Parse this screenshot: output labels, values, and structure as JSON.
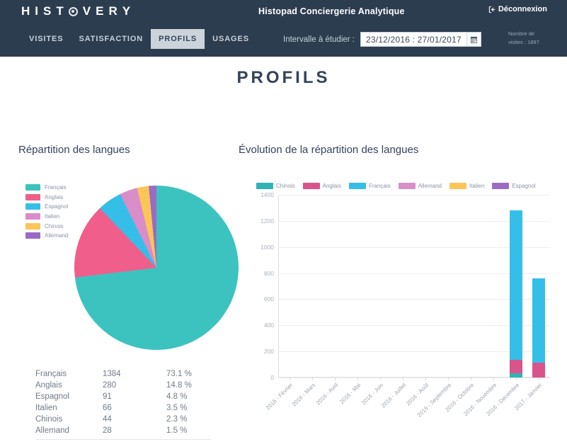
{
  "header": {
    "logo_text": "HISTOVERY",
    "logo_letters": [
      "H",
      "I",
      "S",
      "T",
      "O",
      "V",
      "E",
      "R",
      "Y"
    ],
    "app_title": "Histopad Conciergerie Analytique",
    "logout_label": "Déconnexion",
    "logout_icon": "logout-icon",
    "nav": [
      {
        "label": "VISITES",
        "active": false
      },
      {
        "label": "SATISFACTION",
        "active": false
      },
      {
        "label": "PROFILS",
        "active": true
      },
      {
        "label": "USAGES",
        "active": false
      }
    ],
    "daterange": {
      "label": "Intervalle à étudier :",
      "value": "23/12/2016 : 27/01/2017",
      "placeholder": "jj/mm/aaaa : jj/mm/aaaa",
      "calendar_icon": "calendar-icon"
    },
    "visit_count_line1": "Nombre de",
    "visit_count_line2": "visites : 1897"
  },
  "page": {
    "title": "PROFILS"
  },
  "panels": {
    "left_title": "Répartition des langues",
    "right_title": "Évolution de la répartition des langues"
  },
  "colors": {
    "navy": "#2d3d50",
    "teal": "#3cc3c0",
    "pink": "#f05f8c",
    "blue": "#35bfe8",
    "lilac": "#d98ec9",
    "yellow": "#fcc558",
    "purple": "#9b6bc4",
    "bar_teal": "#2fb3b5",
    "bar_pink": "#d9548a",
    "bar_blue": "#35bfe8"
  },
  "chart_data": [
    {
      "type": "pie",
      "title": "Répartition des langues",
      "legend_position": "left",
      "categories": [
        "Français",
        "Anglais",
        "Espagnol",
        "Italien",
        "Chinois",
        "Allemand"
      ],
      "values": [
        1384,
        280,
        91,
        66,
        44,
        28
      ],
      "percents": [
        "73.1 %",
        "14.8 %",
        "4.8 %",
        "3.5 %",
        "2.3 %",
        "1.5 %"
      ],
      "percent_values": [
        73.1,
        14.8,
        4.8,
        3.5,
        2.3,
        1.5
      ],
      "slice_colors": [
        "#3cc3c0",
        "#f05f8c",
        "#35bfe8",
        "#d98ec9",
        "#fcc558",
        "#9b6bc4"
      ],
      "legend": [
        {
          "label": "Français",
          "color": "#3cc3c0"
        },
        {
          "label": "Anglais",
          "color": "#f05f8c"
        },
        {
          "label": "Espagnol",
          "color": "#35bfe8"
        },
        {
          "label": "Italien",
          "color": "#d98ec9"
        },
        {
          "label": "Chinois",
          "color": "#fcc558"
        },
        {
          "label": "Allemand",
          "color": "#9b6bc4"
        }
      ],
      "table": {
        "rows": [
          {
            "lang": "Français",
            "count": "1384",
            "pct": "73.1 %"
          },
          {
            "lang": "Anglais",
            "count": "280",
            "pct": "14.8 %"
          },
          {
            "lang": "Espagnol",
            "count": "91",
            "pct": "4.8 %"
          },
          {
            "lang": "Italien",
            "count": "66",
            "pct": "3.5 %"
          },
          {
            "lang": "Chinois",
            "count": "44",
            "pct": "2.3 %"
          },
          {
            "lang": "Allemand",
            "count": "28",
            "pct": "1.5 %"
          }
        ]
      }
    },
    {
      "type": "bar",
      "stacked": true,
      "title": "Évolution de la répartition des langues",
      "legend_position": "top",
      "xlabel": "",
      "ylabel": "",
      "ylim": [
        0,
        1400
      ],
      "yticks": [
        0,
        200,
        400,
        600,
        800,
        1000,
        1200,
        1400
      ],
      "ytick_labels": [
        "0",
        "200",
        "400",
        "600",
        "800",
        "1000",
        "1200",
        "1400"
      ],
      "grid": true,
      "categories": [
        "2016 - Février",
        "2016 - Mars",
        "2016 - Avril",
        "2016 - Mai",
        "2016 - Juin",
        "2016 - Juillet",
        "2016 - Août",
        "2016 - Septembre",
        "2016 - Octobre",
        "2016 - Novembre",
        "2016 - Décembre",
        "2017 - Janvier"
      ],
      "legend": [
        {
          "label": "Chinois",
          "color": "#2fb3b5"
        },
        {
          "label": "Anglais",
          "color": "#d9548a"
        },
        {
          "label": "Français",
          "color": "#35bfe8"
        },
        {
          "label": "Allemand",
          "color": "#d98ec9"
        },
        {
          "label": "Italien",
          "color": "#fcc558"
        },
        {
          "label": "Espagnol",
          "color": "#9b6bc4"
        }
      ],
      "series": [
        {
          "name": "Chinois",
          "color": "#2fb3b5",
          "values": [
            0,
            0,
            0,
            0,
            0,
            0,
            0,
            0,
            0,
            0,
            30,
            0
          ]
        },
        {
          "name": "Anglais",
          "color": "#d9548a",
          "values": [
            0,
            0,
            0,
            0,
            0,
            0,
            0,
            0,
            0,
            0,
            105,
            115
          ]
        },
        {
          "name": "Français",
          "color": "#35bfe8",
          "values": [
            0,
            0,
            0,
            0,
            0,
            0,
            0,
            0,
            0,
            0,
            1145,
            645
          ]
        },
        {
          "name": "Allemand",
          "color": "#d98ec9",
          "values": [
            0,
            0,
            0,
            0,
            0,
            0,
            0,
            0,
            0,
            0,
            0,
            0
          ]
        },
        {
          "name": "Italien",
          "color": "#fcc558",
          "values": [
            0,
            0,
            0,
            0,
            0,
            0,
            0,
            0,
            0,
            0,
            0,
            0
          ]
        },
        {
          "name": "Espagnol",
          "color": "#9b6bc4",
          "values": [
            0,
            0,
            0,
            0,
            0,
            0,
            0,
            0,
            0,
            0,
            0,
            0
          ]
        }
      ],
      "totals": [
        0,
        0,
        0,
        0,
        0,
        0,
        0,
        0,
        0,
        0,
        1280,
        760
      ]
    }
  ]
}
